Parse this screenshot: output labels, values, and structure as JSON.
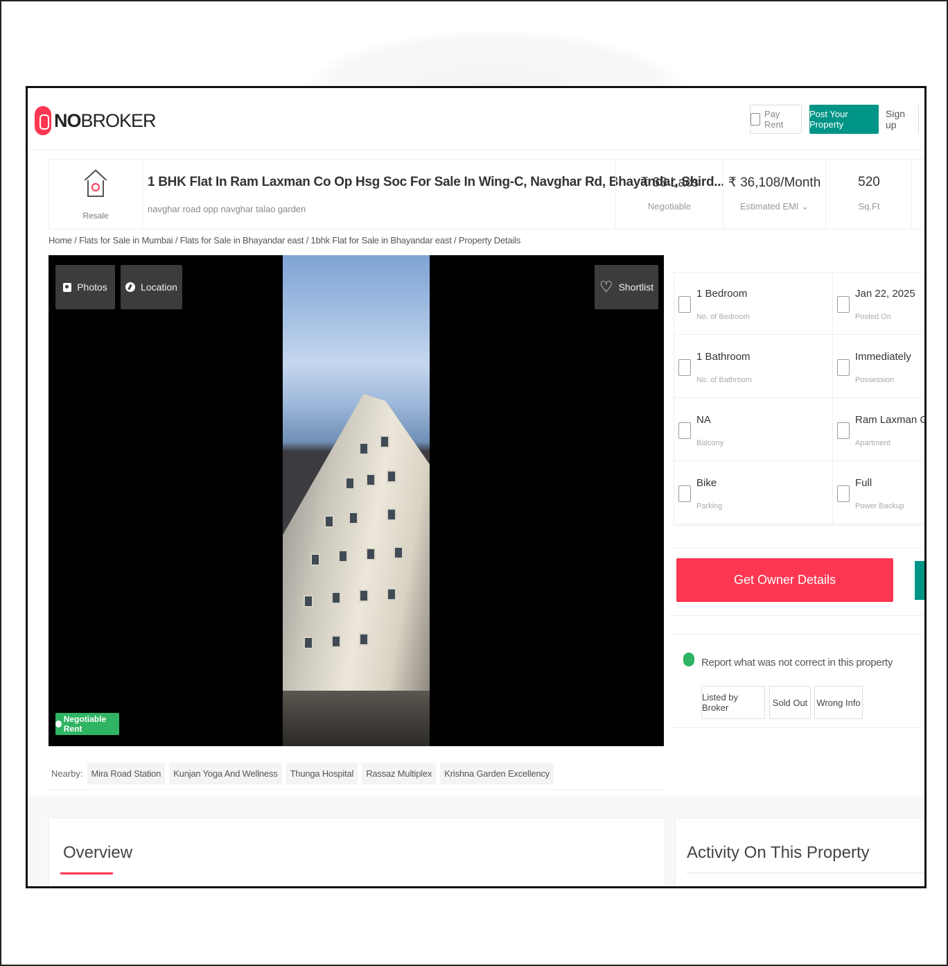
{
  "header": {
    "logo_text_bold": "NO",
    "logo_text_rest": "BROKER",
    "pay_rent": "Pay Rent",
    "post_property": "Post Your Property",
    "sign_up": "Sign up"
  },
  "listing": {
    "badge_label": "Resale",
    "title": "1 BHK Flat In Ram Laxman Co Op Hsg Soc For Sale In Wing-C, Navghar Rd, Bhayandar, Shird...",
    "subtitle": "navghar road opp navghar talao garden",
    "price": {
      "value": "₹ 63 Lacs",
      "label": "Negotiable"
    },
    "emi": {
      "value": "₹ 36,108/Month",
      "label": "Estimated EMI ⌄"
    },
    "area": {
      "value": "520",
      "label": "Sq.Ft"
    }
  },
  "breadcrumb": "Home / Flats for Sale in Mumbai / Flats for Sale in Bhayandar east / 1bhk Flat for Sale in Bhayandar east / Property Details",
  "gallery": {
    "photos_label": "Photos",
    "location_label": "Location",
    "shortlist_label": "Shortlist",
    "negotiable_label": "Negotiable Rent"
  },
  "nearby": {
    "label": "Nearby:",
    "items": [
      "Mira Road Station",
      "Kunjan Yoga And Wellness",
      "Thunga Hospital",
      "Rassaz Multiplex",
      "Krishna Garden Excellency"
    ]
  },
  "specs": [
    {
      "value": "1 Bedroom",
      "label": "No. of Bedroom",
      "icon": "bed-icon"
    },
    {
      "value": "Jan 22, 2025",
      "label": "Posted On",
      "icon": "calendar-icon"
    },
    {
      "value": "1 Bathroom",
      "label": "No. of Bathroom",
      "icon": "bathtub-icon"
    },
    {
      "value": "Immediately",
      "label": "Possession",
      "icon": "key-icon"
    },
    {
      "value": "NA",
      "label": "Balcony",
      "icon": "balcony-icon"
    },
    {
      "value": "Ram Laxman Co Op...",
      "label": "Apartment",
      "icon": "building-icon"
    },
    {
      "value": "Bike",
      "label": "Parking",
      "icon": "car-icon"
    },
    {
      "value": "Full",
      "label": "Power Backup",
      "icon": "battery-icon"
    }
  ],
  "owner_button": "Get Owner Details",
  "report": {
    "text": "Report what was not correct in this property",
    "buttons": [
      "Listed by Broker",
      "Sold Out",
      "Wrong Info"
    ]
  },
  "sections": {
    "overview": "Overview",
    "activity": "Activity On This Property"
  },
  "colors": {
    "brand_red": "#fd3752",
    "brand_green": "#009587",
    "negotiable_green": "#2fb463"
  }
}
